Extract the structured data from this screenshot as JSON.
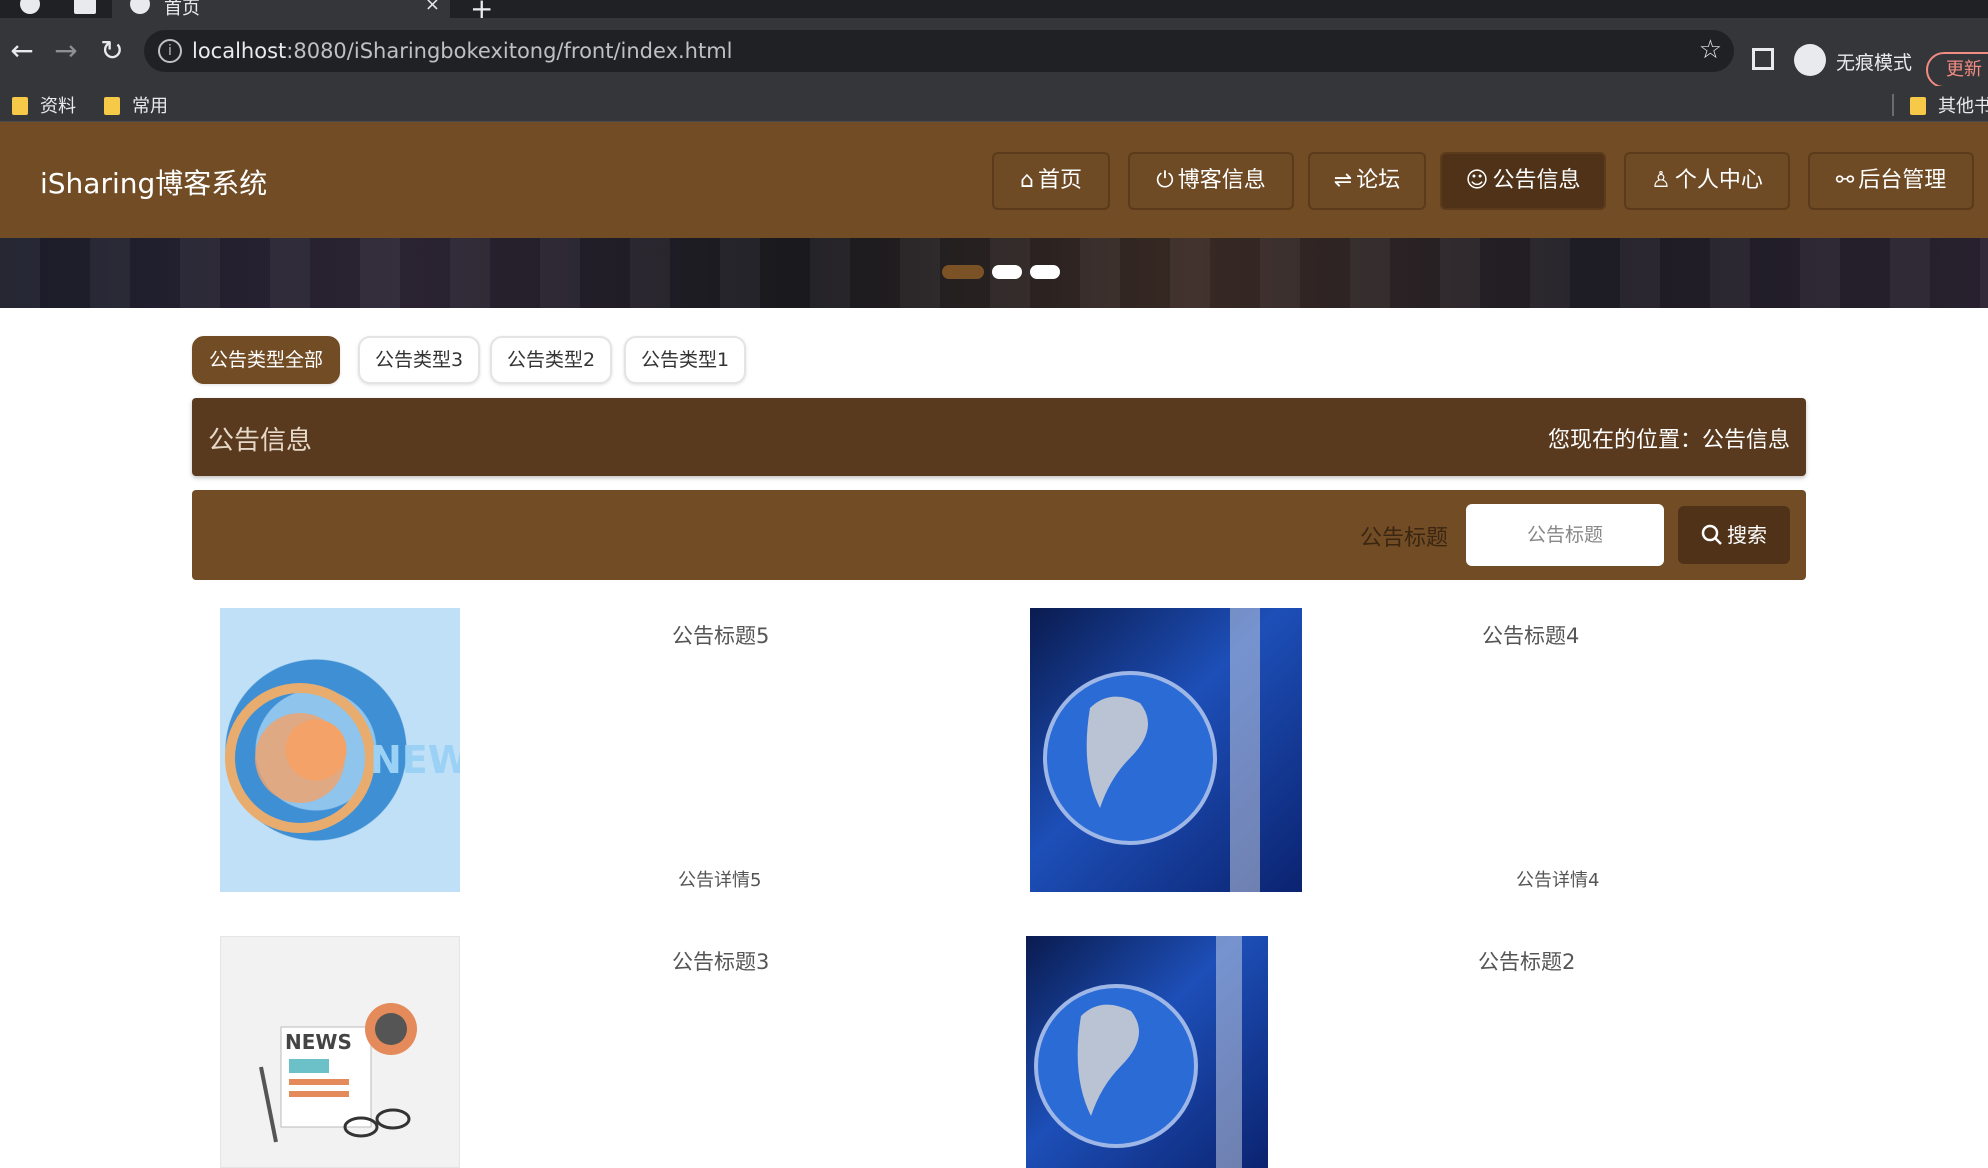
{
  "browser": {
    "tab_title": "首页",
    "tab_close": "×",
    "new_tab": "+",
    "url_host": "localhost",
    "url_rest": ":8080/iSharingbokexitong/front/index.html",
    "incognito_label": "无痕模式",
    "update_label": "更新",
    "bookmarks": [
      "资料",
      "常用"
    ],
    "other_bookmarks": "其他书签"
  },
  "site": {
    "title": "iSharing博客系统",
    "nav": [
      {
        "label": "首页",
        "icon": "home-icon",
        "glyph": "⌂"
      },
      {
        "label": "博客信息",
        "icon": "power-icon",
        "glyph": "⏻"
      },
      {
        "label": "论坛",
        "icon": "sliders-icon",
        "glyph": "⇌"
      },
      {
        "label": "公告信息",
        "icon": "smile-icon",
        "glyph": "☺"
      },
      {
        "label": "个人中心",
        "icon": "user-icon",
        "glyph": "♙"
      },
      {
        "label": "后台管理",
        "icon": "link-icon",
        "glyph": "⚯"
      }
    ],
    "active_nav": "公告信息"
  },
  "carousel": {
    "slide_count": 3,
    "active_slide": 1
  },
  "types": [
    "公告类型全部",
    "公告类型3",
    "公告类型2",
    "公告类型1"
  ],
  "page": {
    "heading": "公告信息",
    "location": "您现在的位置：公告信息"
  },
  "search": {
    "label": "公告标题",
    "placeholder": "公告标题",
    "button": "搜索"
  },
  "notices": [
    {
      "title": "公告标题5",
      "detail": "公告详情5",
      "image": "news-globe-orange"
    },
    {
      "title": "公告标题4",
      "detail": "公告详情4",
      "image": "news-globe-blue"
    },
    {
      "title": "公告标题3",
      "detail": "",
      "image": "newspaper-illustration"
    },
    {
      "title": "公告标题2",
      "detail": "",
      "image": "news-globe-blue"
    }
  ],
  "colors": {
    "brand": "#714c25",
    "brand_dark": "#4f3218",
    "title_bar": "#5a3a1e"
  }
}
